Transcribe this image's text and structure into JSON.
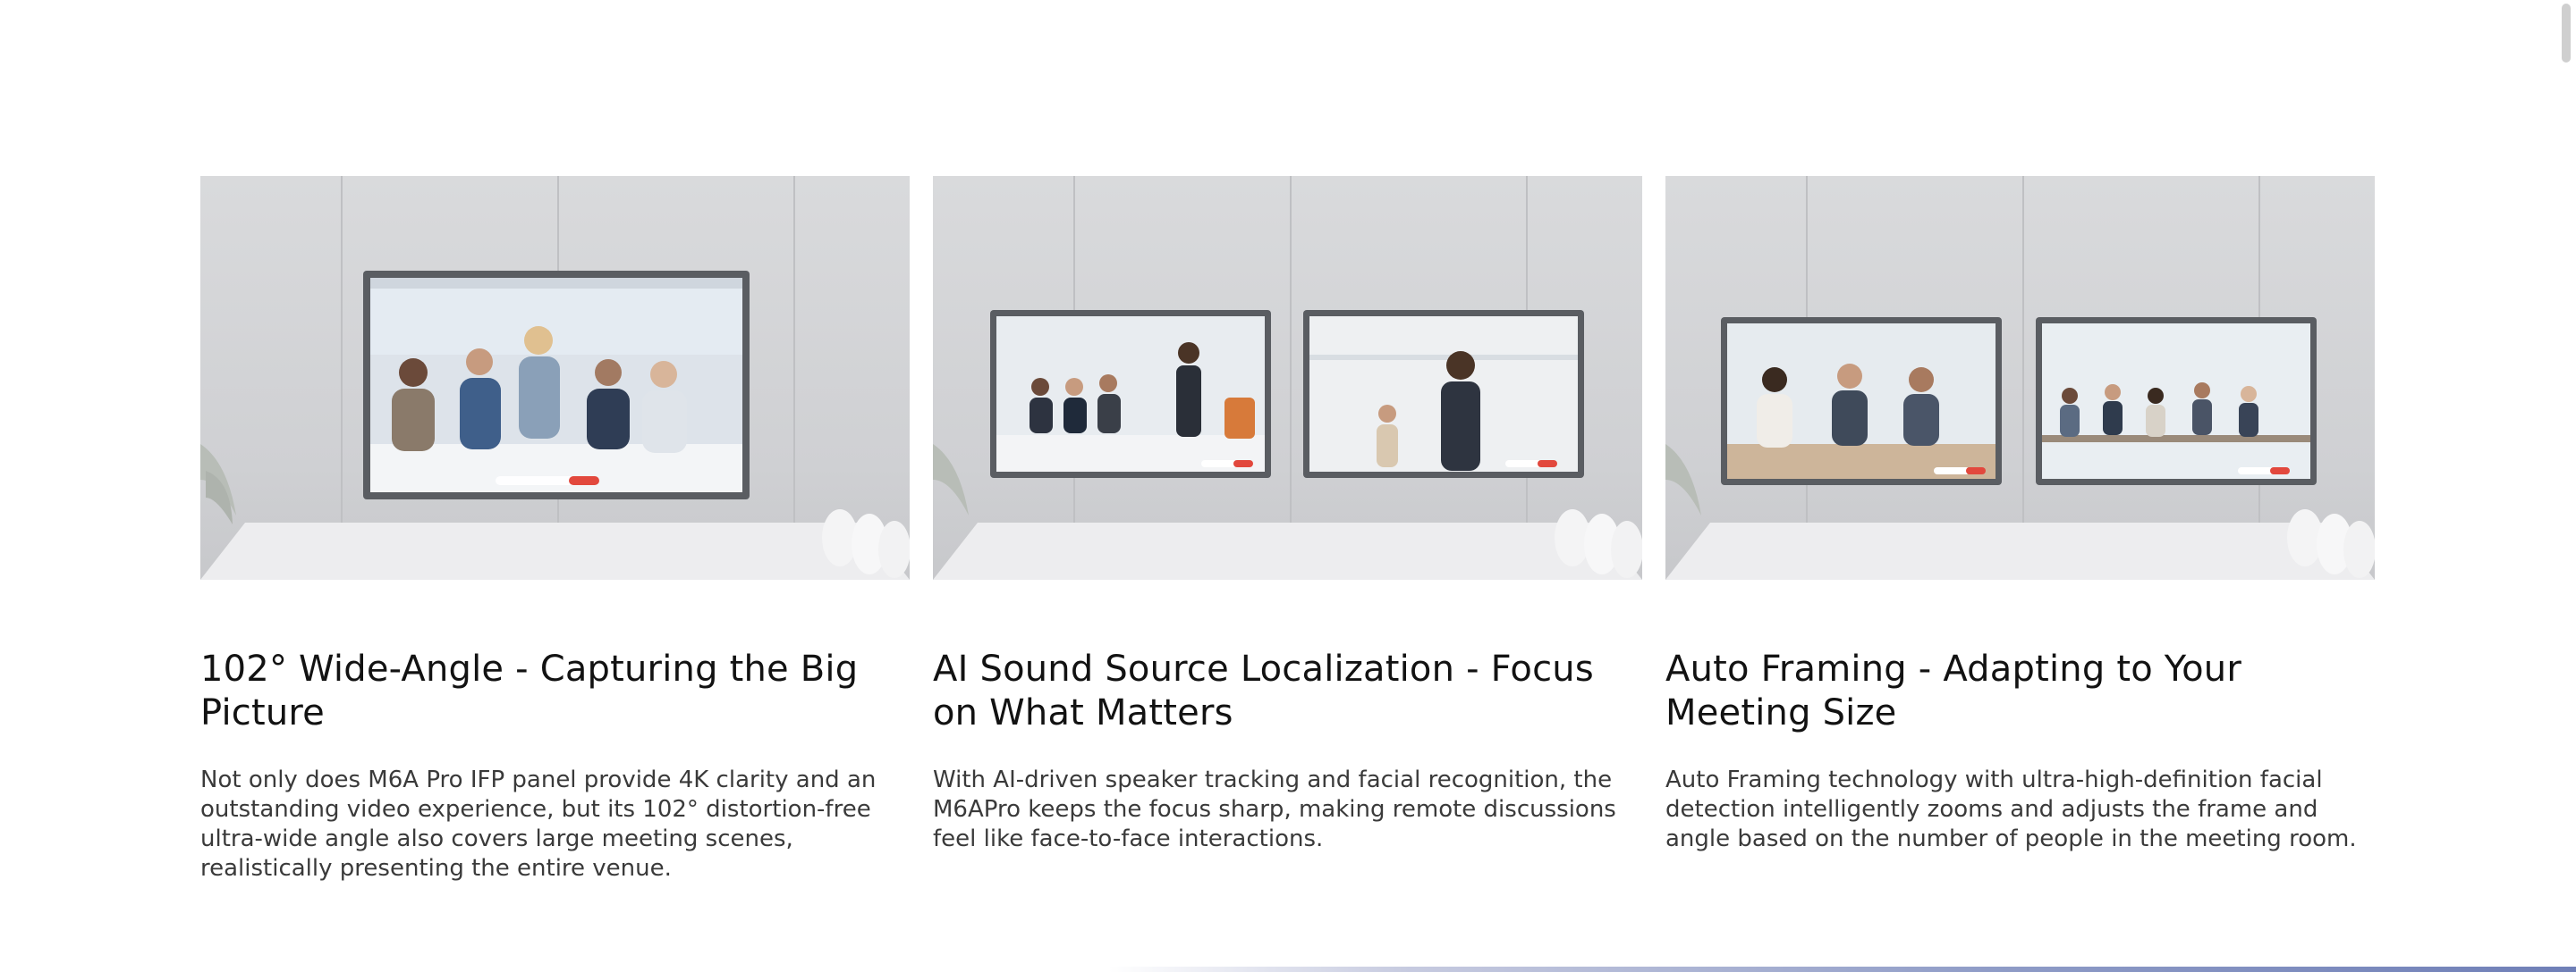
{
  "features": [
    {
      "title": "102° Wide-Angle - Capturing the Big Picture",
      "description": "Not only does M6A Pro IFP panel provide 4K clarity and an outstanding video experience, but its 102° distortion-free ultra-wide angle also covers large meeting scenes, realistically presenting the entire venue.",
      "image": "single-wide-display-conference-scene"
    },
    {
      "title": "AI Sound Source Localization - Focus on What Matters",
      "description": "With AI-driven speaker tracking and facial recognition, the M6APro keeps the focus sharp, making remote discussions feel like face-to-face interactions.",
      "image": "dual-display-speaker-tracking-scene"
    },
    {
      "title": "Auto Framing - Adapting to Your Meeting Size",
      "description": "Auto Framing technology with ultra-high-definition facial detection intelligently zooms and adjusts the frame and angle based on the number of people in the meeting room.",
      "image": "dual-display-auto-framing-scene"
    }
  ],
  "colors": {
    "title": "#121212",
    "body": "#3a3a3a",
    "scene_wall": "#d2d3d6",
    "scene_table": "#ececee",
    "screen_bezel": "#5a5d62",
    "end_call_red": "#e2483d"
  }
}
